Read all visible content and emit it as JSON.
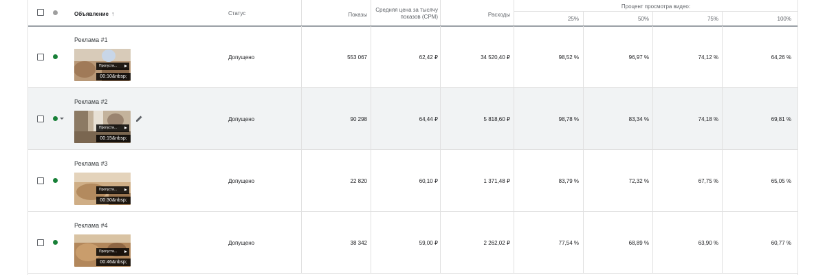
{
  "header": {
    "ad_label": "Объявление",
    "sort_arrow": "↑",
    "status_label": "Статус",
    "impressions_label": "Показы",
    "cpm_label_line1": "Средняя цена за тысячу",
    "cpm_label_line2": "показов (CPM)",
    "cost_label": "Расходы",
    "video_group_label": "Процент просмотра видео:",
    "q25": "25%",
    "q50": "50%",
    "q75": "75%",
    "q100": "100%"
  },
  "rows": [
    {
      "name": "Реклама #1",
      "status": "Допущено",
      "impressions": "553 067",
      "cpm": "62,42 ₽",
      "cost": "34 520,40 ₽",
      "p25": "98,52 %",
      "p50": "96,97 %",
      "p75": "74,12 %",
      "p100": "64,26 %",
      "skip": "Пропусти...",
      "duration": "00:10&nbsp;"
    },
    {
      "name": "Реклама #2",
      "status": "Допущено",
      "impressions": "90 298",
      "cpm": "64,44 ₽",
      "cost": "5 818,60 ₽",
      "p25": "98,78 %",
      "p50": "83,34 %",
      "p75": "74,18 %",
      "p100": "69,81 %",
      "skip": "Пропусти...",
      "duration": "00:15&nbsp;"
    },
    {
      "name": "Реклама #3",
      "status": "Допущено",
      "impressions": "22 820",
      "cpm": "60,10 ₽",
      "cost": "1 371,48 ₽",
      "p25": "83,79 %",
      "p50": "72,32 %",
      "p75": "67,75 %",
      "p100": "65,05 %",
      "skip": "Пропусти...",
      "duration": "00:30&nbsp;"
    },
    {
      "name": "Реклама #4",
      "status": "Допущено",
      "impressions": "38 342",
      "cpm": "59,00 ₽",
      "cost": "2 262,02 ₽",
      "p25": "77,54 %",
      "p50": "68,89 %",
      "p75": "63,90 %",
      "p100": "60,77 %",
      "skip": "Пропусти...",
      "duration": "00:46&nbsp;"
    }
  ],
  "colors": {
    "status_dot": "#188038",
    "header_dot": "#9e9e9e",
    "highlight_row": "#f1f3f4"
  }
}
